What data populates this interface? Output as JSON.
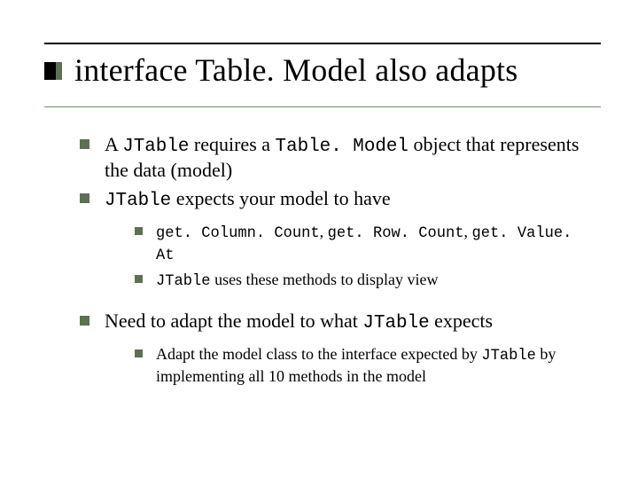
{
  "title": "interface Table. Model also adapts",
  "bullets": {
    "b1": {
      "p1": "A ",
      "c1": "JTable",
      "p2": " requires a ",
      "c2": "Table. Model",
      "p3": " object that represents the data (model)"
    },
    "b2": {
      "c1": "JTable",
      "p1": " expects your model to have"
    },
    "b2_sub": {
      "s1": {
        "c1": "get. Column. Count",
        "sep1": ", ",
        "c2": "get. Row. Count",
        "sep2": ", ",
        "c3": "get. Value. At"
      },
      "s2": {
        "c1": "JTable",
        "p1": " uses these methods to display view"
      }
    },
    "b3": {
      "p1": "Need to adapt the model to what ",
      "c1": "JTable",
      "p2": " expects"
    },
    "b3_sub": {
      "s1": {
        "p1": "Adapt the model class to the interface expected by ",
        "c1": "JTable",
        "p2": " by implementing all 10 methods in the model"
      }
    }
  }
}
